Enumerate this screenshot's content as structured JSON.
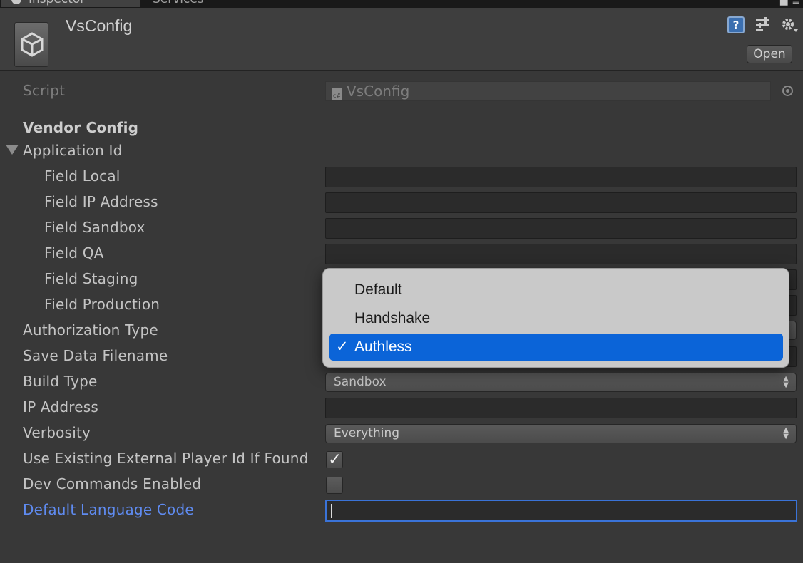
{
  "tabs": [
    {
      "label": "Inspector"
    },
    {
      "label": "Services"
    }
  ],
  "header": {
    "title": "VsConfig",
    "open_label": "Open",
    "icons": [
      "help-icon",
      "preset-icon",
      "gear-icon"
    ]
  },
  "script": {
    "label": "Script",
    "value": "VsConfig",
    "icon": "csharp-script-icon"
  },
  "section": {
    "title": "Vendor Config",
    "foldout_label": "Application Id"
  },
  "fields": {
    "field_local": "Field Local",
    "field_ip": "Field IP Address",
    "field_sandbox": "Field Sandbox",
    "field_qa": "Field QA",
    "field_staging": "Field Staging",
    "field_production": "Field Production",
    "authorization_type": "Authorization Type",
    "save_data_filename": "Save Data Filename",
    "build_type": "Build Type",
    "ip_address": "IP Address",
    "verbosity": "Verbosity",
    "use_existing_id": "Use Existing External Player Id If Found",
    "dev_commands": "Dev Commands Enabled",
    "default_language": "Default Language Code"
  },
  "values": {
    "build_type": "Sandbox",
    "verbosity": "Everything",
    "use_existing_id_checked": true,
    "dev_commands_checked": false,
    "default_language": ""
  },
  "popup": {
    "items": [
      "Default",
      "Handshake",
      "Authless"
    ],
    "selected": "Authless",
    "check_glyph": "✓"
  },
  "colors": {
    "background": "#383838",
    "focus_label": "#5f8bf0",
    "menu_selected": "#0b64d8"
  }
}
